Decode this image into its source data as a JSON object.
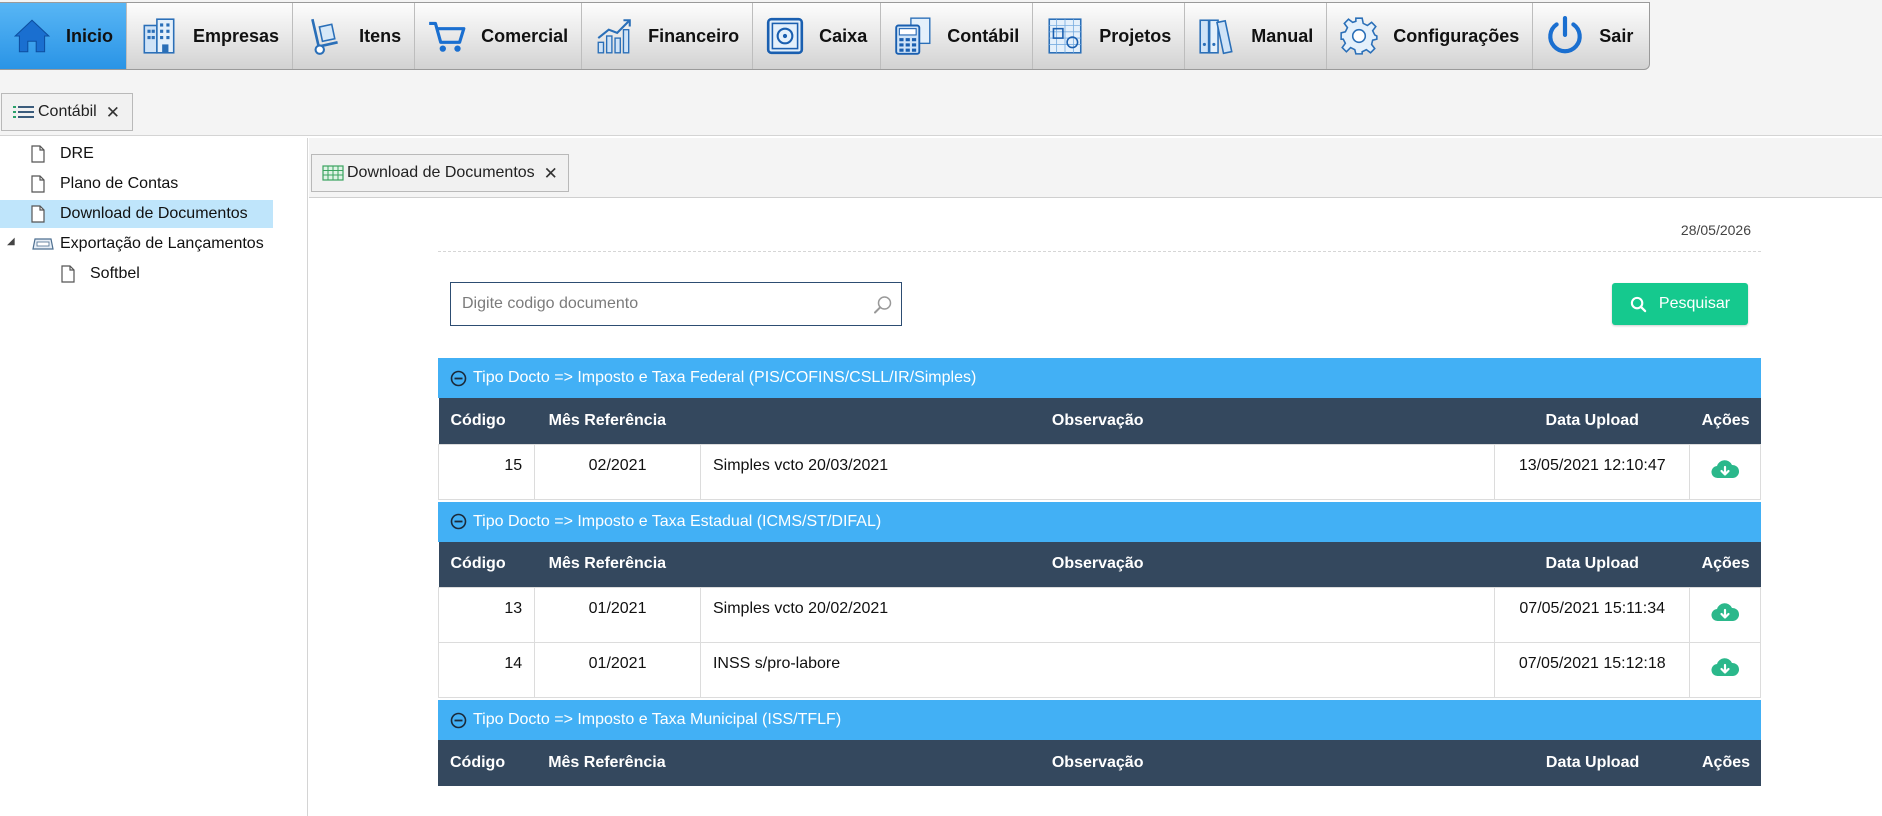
{
  "menu": {
    "items": [
      {
        "id": "inicio",
        "label": "Inicio",
        "icon": "home-icon",
        "active": true
      },
      {
        "id": "empresas",
        "label": "Empresas",
        "icon": "building-icon"
      },
      {
        "id": "itens",
        "label": "Itens",
        "icon": "hand-truck-icon"
      },
      {
        "id": "comercial",
        "label": "Comercial",
        "icon": "shopping-cart-icon"
      },
      {
        "id": "financeiro",
        "label": "Financeiro",
        "icon": "bar-chart-icon"
      },
      {
        "id": "caixa",
        "label": "Caixa",
        "icon": "safe-icon"
      },
      {
        "id": "contabil",
        "label": "Contábil",
        "icon": "calculator-icon"
      },
      {
        "id": "projetos",
        "label": "Projetos",
        "icon": "blueprint-icon"
      },
      {
        "id": "manual",
        "label": "Manual",
        "icon": "binders-icon"
      },
      {
        "id": "configuracoes",
        "label": "Configurações",
        "icon": "gear-icon"
      },
      {
        "id": "sair",
        "label": "Sair",
        "icon": "power-icon"
      }
    ]
  },
  "outer_tab": {
    "label": "Contábil",
    "icon": "list-icon",
    "close": "✕"
  },
  "tree": {
    "items": [
      {
        "label": "DRE",
        "icon": "document-icon"
      },
      {
        "label": "Plano de Contas",
        "icon": "document-icon"
      },
      {
        "label": "Download de Documentos",
        "icon": "document-icon",
        "selected": true
      },
      {
        "label": "Exportação de Lançamentos",
        "icon": "folder-icon",
        "expander": "◢"
      },
      {
        "label": "Softbel",
        "icon": "document-icon"
      }
    ]
  },
  "inner_tab": {
    "label": "Download de Documentos",
    "icon": "grid-icon",
    "close": "✕"
  },
  "page": {
    "date": "28/05/2026",
    "search_placeholder": "Digite codigo documento",
    "search_button": "Pesquisar"
  },
  "columns": {
    "codigo": "Código",
    "mes": "Mês Referência",
    "observacao": "Observação",
    "data_upload": "Data Upload",
    "acoes": "Ações"
  },
  "groups": [
    {
      "title": "Tipo Docto => Imposto e Taxa Federal (PIS/COFINS/CSLL/IR/Simples)",
      "rows": [
        {
          "codigo": "15",
          "mes": "02/2021",
          "observacao": "Simples vcto 20/03/2021",
          "data_upload": "13/05/2021 12:10:47"
        }
      ]
    },
    {
      "title": "Tipo Docto => Imposto e Taxa Estadual (ICMS/ST/DIFAL)",
      "rows": [
        {
          "codigo": "13",
          "mes": "01/2021",
          "observacao": "Simples vcto 20/02/2021",
          "data_upload": "07/05/2021 15:11:34"
        },
        {
          "codigo": "14",
          "mes": "01/2021",
          "observacao": "INSS s/pro-labore",
          "data_upload": "07/05/2021 15:12:18"
        }
      ]
    },
    {
      "title": "Tipo Docto => Imposto e Taxa Municipal (ISS/TFLF)",
      "rows": []
    }
  ],
  "colors": {
    "menu_active": "#2a94e6",
    "group_header": "#42b0f5",
    "table_header": "#34485e",
    "search_button": "#15c98e",
    "download_icon": "#2bb88b",
    "tree_selected": "#bfe5fb"
  }
}
